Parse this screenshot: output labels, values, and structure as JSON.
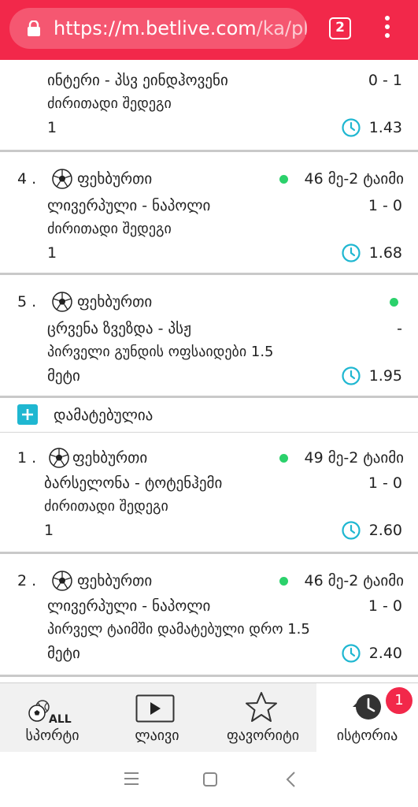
{
  "browser": {
    "url_host": "https://m.betlive.com",
    "url_path": "/ka/play",
    "tab_count": "2"
  },
  "bets_top": [
    {
      "index": "",
      "event": "ინტერი - პსვ ეინდჰოვენი",
      "score": "0 - 1",
      "market": "ძირითადი შედეგი",
      "selection": "1",
      "odds": "1.43"
    },
    {
      "index": "4 .",
      "sport": "ფეხბურთი",
      "time": "46 მე-2 ტაიმი",
      "event": "ლივერპული - ნაპოლი",
      "score": "1 - 0",
      "market": "ძირითადი შედეგი",
      "selection": "1",
      "odds": "1.68"
    },
    {
      "index": "5 .",
      "sport": "ფეხბურთი",
      "time": "",
      "event": "ცრვენა ზვეზდა - პსჟ",
      "score": "-",
      "market": "პირველი გუნდის ოფსაიდები 1.5",
      "selection": "მეტი",
      "odds": "1.95"
    }
  ],
  "added_label": "დამატებულია",
  "bets_added": [
    {
      "index": "1 .",
      "sport": "ფეხბურთი",
      "time": "49 მე-2 ტაიმი",
      "event": "ბარსელონა - ტოტენჰემი",
      "score": "1 - 0",
      "market": "ძირითადი შედეგი",
      "selection": "1",
      "odds": "2.60"
    },
    {
      "index": "2 .",
      "sport": "ფეხბურთი",
      "time": "46 მე-2 ტაიმი",
      "event": "ლივერპული - ნაპოლი",
      "score": "1 - 0",
      "market": "პირველ ტაიმში დამატებული დრო 1.5",
      "selection": "მეტი",
      "odds": "2.40"
    }
  ],
  "nav": {
    "sports": "სპორტი",
    "sports_icon_text": "ALL",
    "live": "ლაივი",
    "favorites": "ფავორიტი",
    "history": "ისტორია",
    "history_badge": "1"
  },
  "colors": {
    "brand": "#f2284a",
    "accent": "#1fb7d1",
    "live": "#2bd16b"
  },
  "icons": [
    "lock-icon",
    "menu-dots-icon",
    "soccer-ball-icon",
    "clock-icon",
    "plus-icon",
    "play-icon",
    "star-icon",
    "history-icon",
    "recents-icon",
    "home-icon",
    "back-icon"
  ]
}
